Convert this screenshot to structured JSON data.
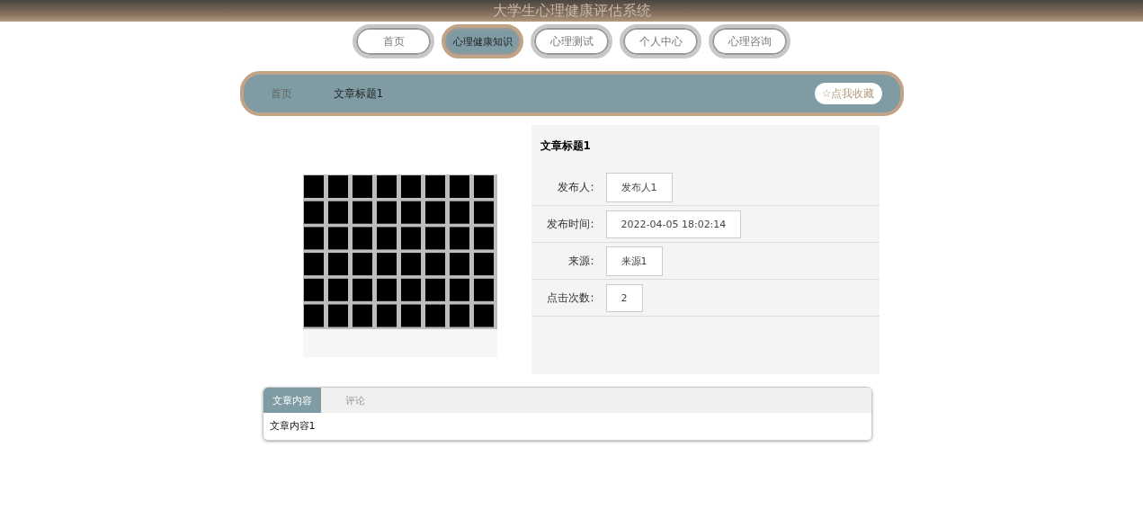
{
  "header": {
    "title": "大学生心理健康评估系统"
  },
  "nav": [
    {
      "label": "首页",
      "selected": false
    },
    {
      "label": "心理健康知识",
      "selected": true
    },
    {
      "label": "心理测试",
      "selected": false
    },
    {
      "label": "个人中心",
      "selected": false
    },
    {
      "label": "心理咨询",
      "selected": false
    }
  ],
  "breadcrumb": {
    "items": [
      "首页",
      "文章标题1"
    ],
    "favorite_button": "☆点我收藏"
  },
  "article": {
    "title": "文章标题1",
    "fields": [
      {
        "label": "发布人:",
        "value": "发布人1"
      },
      {
        "label": "发布时间:",
        "value": "2022-04-05 18:02:14"
      },
      {
        "label": "来源:",
        "value": "来源1"
      },
      {
        "label": "点击次数:",
        "value": "2"
      }
    ]
  },
  "tabs": [
    {
      "label": "文章内容",
      "selected": true
    },
    {
      "label": "评论",
      "selected": false
    }
  ],
  "tab_content": "文章内容1"
}
